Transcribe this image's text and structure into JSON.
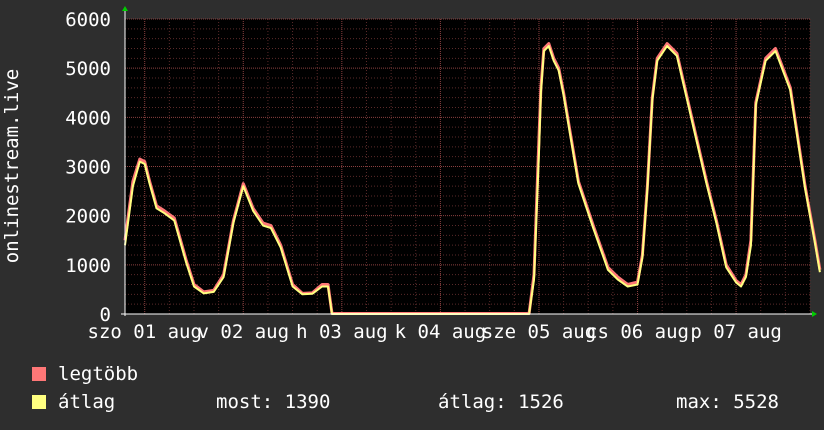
{
  "chart_data": {
    "type": "area",
    "ylabel": "onlinestream.live",
    "ylim": [
      0,
      6000
    ],
    "yticks": [
      0,
      1000,
      2000,
      3000,
      4000,
      5000,
      6000
    ],
    "xlim": [
      -0.2,
      6.75
    ],
    "xtick_labels": [
      "szo 01 aug",
      "v 02 aug",
      "h 03 aug",
      "k 04 aug",
      "sze 05 aug",
      "cs 06 aug",
      "p 07 aug"
    ],
    "xtick_positions": [
      0,
      1,
      2,
      3,
      4,
      5,
      6
    ],
    "grid": true,
    "series": [
      {
        "name": "legtöbb",
        "color": "#ff7777",
        "x": [
          -0.2,
          -0.12,
          -0.05,
          0.0,
          0.05,
          0.12,
          0.2,
          0.3,
          0.42,
          0.5,
          0.6,
          0.7,
          0.8,
          0.9,
          1.0,
          1.1,
          1.2,
          1.28,
          1.38,
          1.5,
          1.6,
          1.7,
          1.8,
          1.86,
          1.9,
          1.92,
          1.95,
          2.0,
          2.5,
          3.0,
          3.5,
          3.9,
          3.95,
          4.0,
          4.02,
          4.05,
          4.1,
          4.15,
          4.2,
          4.25,
          4.3,
          4.4,
          4.55,
          4.7,
          4.8,
          4.9,
          5.0,
          5.05,
          5.1,
          5.15,
          5.2,
          5.3,
          5.4,
          5.55,
          5.7,
          5.8,
          5.9,
          6.0,
          6.05,
          6.1,
          6.15,
          6.2,
          6.3,
          6.4,
          6.55,
          6.7,
          6.8,
          6.85
        ],
        "y": [
          1500,
          2700,
          3150,
          3100,
          2700,
          2200,
          2100,
          1950,
          1100,
          600,
          450,
          480,
          800,
          1900,
          2650,
          2150,
          1850,
          1800,
          1400,
          600,
          420,
          430,
          600,
          600,
          10,
          10,
          10,
          10,
          10,
          10,
          10,
          10,
          800,
          3600,
          4600,
          5400,
          5500,
          5200,
          5000,
          4500,
          3900,
          2700,
          1800,
          950,
          750,
          600,
          650,
          1200,
          2600,
          4400,
          5200,
          5500,
          5300,
          4000,
          2700,
          1900,
          1000,
          680,
          600,
          800,
          1500,
          4300,
          5200,
          5400,
          4600,
          2600,
          1500,
          900
        ]
      },
      {
        "name": "átlag",
        "color": "#ffff80",
        "x": [
          -0.2,
          -0.12,
          -0.05,
          0.0,
          0.05,
          0.12,
          0.2,
          0.3,
          0.42,
          0.5,
          0.6,
          0.7,
          0.8,
          0.9,
          1.0,
          1.1,
          1.2,
          1.28,
          1.38,
          1.5,
          1.6,
          1.7,
          1.8,
          1.86,
          1.9,
          1.92,
          1.95,
          2.0,
          2.5,
          3.0,
          3.5,
          3.9,
          3.95,
          4.0,
          4.02,
          4.05,
          4.1,
          4.15,
          4.2,
          4.25,
          4.3,
          4.4,
          4.55,
          4.7,
          4.8,
          4.9,
          5.0,
          5.05,
          5.1,
          5.15,
          5.2,
          5.3,
          5.4,
          5.55,
          5.7,
          5.8,
          5.9,
          6.0,
          6.05,
          6.1,
          6.15,
          6.2,
          6.3,
          6.4,
          6.55,
          6.7,
          6.8,
          6.85
        ],
        "y": [
          1400,
          2600,
          3100,
          3050,
          2650,
          2150,
          2050,
          1900,
          1050,
          560,
          420,
          450,
          750,
          1850,
          2600,
          2100,
          1800,
          1750,
          1350,
          560,
          400,
          410,
          560,
          560,
          0,
          0,
          0,
          0,
          0,
          0,
          0,
          0,
          700,
          3300,
          4500,
          5350,
          5450,
          5150,
          4950,
          4450,
          3850,
          2650,
          1750,
          900,
          700,
          560,
          600,
          1150,
          2550,
          4350,
          5150,
          5450,
          5250,
          3950,
          2650,
          1850,
          950,
          640,
          560,
          750,
          1390,
          4250,
          5150,
          5350,
          4550,
          2550,
          1450,
          850
        ]
      }
    ]
  },
  "legend": [
    {
      "label": "legtöbb",
      "color": "#ff7777"
    },
    {
      "label": "átlag",
      "color": "#ffff80"
    }
  ],
  "stats": {
    "most": "most: 1390",
    "atlag": "átlag: 1526",
    "max": "max: 5528"
  }
}
